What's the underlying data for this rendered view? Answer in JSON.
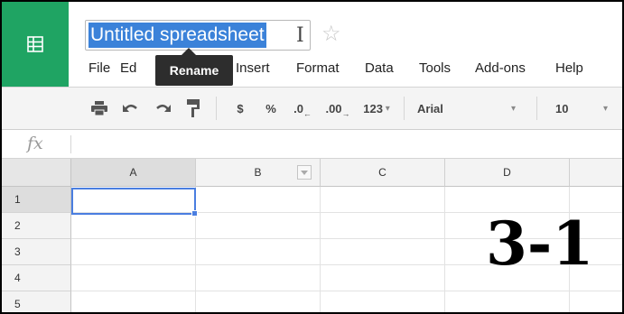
{
  "app": {
    "document_title": "Untitled spreadsheet",
    "brand_color": "#1fa463",
    "selection_color": "#4a7ee0"
  },
  "menubar": {
    "items": [
      "File",
      "Ed",
      "Insert",
      "Format",
      "Data",
      "Tools",
      "Add-ons",
      "Help"
    ]
  },
  "tooltip": {
    "text": "Rename"
  },
  "toolbar": {
    "icons": [
      "print-icon",
      "undo-icon",
      "redo-icon",
      "paint-format-icon"
    ],
    "currency": "$",
    "percent": "%",
    "decrease_decimal": ".0",
    "increase_decimal": ".00",
    "number_format": "123",
    "font": "Arial",
    "font_size": "10"
  },
  "formula_bar": {
    "icon": "fx",
    "value": ""
  },
  "grid": {
    "columns": [
      "A",
      "B",
      "C",
      "D"
    ],
    "rows": [
      "1",
      "2",
      "3",
      "4",
      "5"
    ],
    "active_cell": "A1"
  },
  "overlay": {
    "label": "3-1"
  }
}
